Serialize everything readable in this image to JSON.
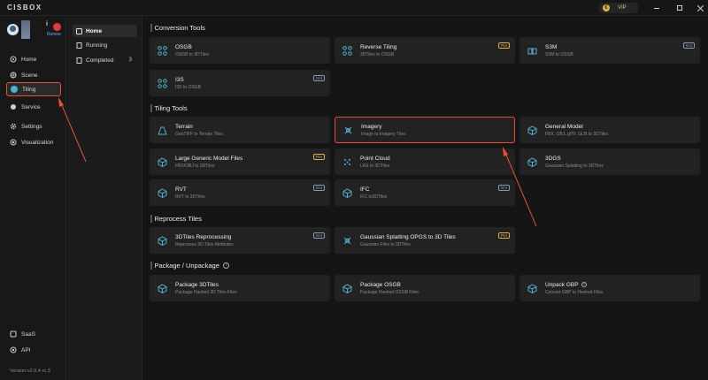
{
  "titlebar": {
    "logo": "CISBOX",
    "vip_label": "VIP",
    "coin_icon": "coin-icon"
  },
  "user": {
    "badge": "i",
    "renew_label": "Renew"
  },
  "sidebar": {
    "items": [
      {
        "label": "Home",
        "icon": "home-icon"
      },
      {
        "label": "Scene",
        "icon": "globe-icon"
      },
      {
        "label": "Tiling",
        "icon": "tiling-icon",
        "active": true
      },
      {
        "label": "Service",
        "icon": "service-icon"
      },
      {
        "label": "Settings",
        "icon": "gear-icon"
      },
      {
        "label": "Visualization",
        "icon": "eye-icon"
      }
    ],
    "bottom_items": [
      {
        "label": "SaaS",
        "icon": "saas-icon"
      },
      {
        "label": "API",
        "icon": "api-icon"
      }
    ],
    "version": "Version:v2.0.4-rc.3"
  },
  "subnav": {
    "items": [
      {
        "label": "Home",
        "icon": "home-icon",
        "active": true
      },
      {
        "label": "Running",
        "icon": "document-icon"
      },
      {
        "label": "Completed",
        "icon": "document-icon",
        "count": "3"
      }
    ]
  },
  "sections": {
    "conversion": "Conversion Tools",
    "tiling": "Tiling Tools",
    "reprocess": "Reprocess Tiles",
    "package": "Package / Unpackage",
    "package_help": "?"
  },
  "tags": {
    "pro": "Pro",
    "ent": "Ent"
  },
  "cards": {
    "osgb": {
      "title": "OSGB",
      "sub": "OSGB to 3DTiles"
    },
    "reverse": {
      "title": "Reverse Tiling",
      "sub": "3DTiles to OSGB"
    },
    "s3m": {
      "title": "S3M",
      "sub": "S3M to OSGB"
    },
    "i3s": {
      "title": "I3S",
      "sub": "I3S to OSGB"
    },
    "terrain": {
      "title": "Terrain",
      "sub": "GeoTIFF to Terrain Tiles"
    },
    "imagery": {
      "title": "Imagery",
      "sub": "Image to Imagery Tiles"
    },
    "general": {
      "title": "General Model",
      "sub": "FBX, OBJ, glTF, GLB to 3DTiles"
    },
    "large": {
      "title": "Large Generic Model Files",
      "sub": "FBX/OBJ to 3DTiles"
    },
    "pointcloud": {
      "title": "Point Cloud",
      "sub": "LAS to 3DTiles"
    },
    "dgs": {
      "title": "3DGS",
      "sub": "Gaussian Splatting to 3DTiles"
    },
    "rvt": {
      "title": "RVT",
      "sub": "RVT to 3DTiles"
    },
    "ifc": {
      "title": "IFC",
      "sub": "IFC to3DTiles"
    },
    "reproc": {
      "title": "3DTiles Reprocessing",
      "sub": "Reprocess 3D Tiles Attributes"
    },
    "gauss": {
      "title": "Gaussian Splatting OPGS to 3D Tiles",
      "sub": "Gaussian Files to 3DTiles"
    },
    "pkg3d": {
      "title": "Package 3DTiles",
      "sub": "Package Hashed 3D Tiles Files"
    },
    "pkgosgb": {
      "title": "Package OSGB",
      "sub": "Package Hashed OSGB Files"
    },
    "unpack": {
      "title": "Unpack GBP",
      "sub": "Convert GBP to Hashed Files",
      "help": "?"
    }
  },
  "colors": {
    "accent": "#e4532d",
    "pro": "#e0b04a",
    "ent": "#8a98b8",
    "icon": "#4fb3d0"
  }
}
